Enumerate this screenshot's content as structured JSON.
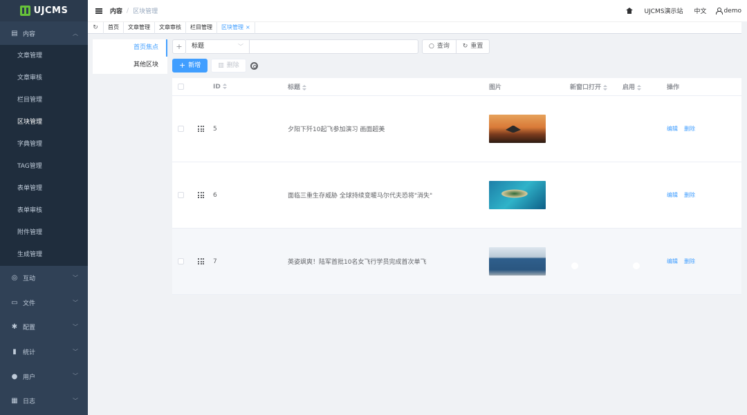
{
  "app": {
    "logo_text": "UJCMS"
  },
  "sidebar": {
    "group_content": {
      "label": "内容",
      "icon": "document-icon"
    },
    "content_items": [
      {
        "label": "文章管理"
      },
      {
        "label": "文章审核"
      },
      {
        "label": "栏目管理"
      },
      {
        "label": "区块管理",
        "active": true
      },
      {
        "label": "字典管理"
      },
      {
        "label": "TAG管理"
      },
      {
        "label": "表单管理"
      },
      {
        "label": "表单审核"
      },
      {
        "label": "附件管理"
      },
      {
        "label": "生成管理"
      }
    ],
    "groups": [
      {
        "label": "互动",
        "icon": "chat-icon"
      },
      {
        "label": "文件",
        "icon": "folder-icon"
      },
      {
        "label": "配置",
        "icon": "gear-icon"
      },
      {
        "label": "统计",
        "icon": "bar-chart-icon"
      },
      {
        "label": "用户",
        "icon": "user-icon"
      },
      {
        "label": "日志",
        "icon": "log-icon"
      }
    ]
  },
  "header": {
    "breadcrumb": {
      "parent": "内容",
      "separator": "/",
      "current": "区块管理"
    },
    "site_name": "UJCMS演示站",
    "language": "中文",
    "username": "demo"
  },
  "tabs": [
    {
      "label": "首页"
    },
    {
      "label": "文章管理"
    },
    {
      "label": "文章审核"
    },
    {
      "label": "栏目管理"
    },
    {
      "label": "区块管理",
      "active": true,
      "close": "×"
    }
  ],
  "subnav": [
    {
      "label": "首页焦点",
      "active": true
    },
    {
      "label": "其他区块"
    }
  ],
  "toolbar": {
    "add_icon": "+",
    "field_select": "标题",
    "search_value": "",
    "query_label": "查询",
    "reset_label": "重置",
    "new_label": "新增",
    "delete_label": "删除"
  },
  "table": {
    "headers": {
      "id": "ID",
      "title": "标题",
      "image": "图片",
      "new_window": "新窗口打开",
      "enabled": "启用",
      "ops": "操作"
    },
    "rows": [
      {
        "id": "5",
        "title": "夕阳下歼10起飞参加演习 画面超美",
        "new_window": false,
        "enabled": true,
        "edit": "编辑",
        "delete": "删除"
      },
      {
        "id": "6",
        "title": "面临三重生存威胁 全球持续变暖马尔代夫恐将\"消失\"",
        "new_window": false,
        "enabled": true,
        "edit": "编辑",
        "delete": "删除"
      },
      {
        "id": "7",
        "title": "英姿飒爽！陆军首批10名女飞行学员完成首次单飞",
        "new_window": false,
        "enabled": true,
        "edit": "编辑",
        "delete": "删除"
      }
    ]
  },
  "colors": {
    "primary": "#409eff",
    "sidebar_bg": "#304156",
    "submenu_bg": "#1f2d3d",
    "logo_green": "#67c23a"
  }
}
